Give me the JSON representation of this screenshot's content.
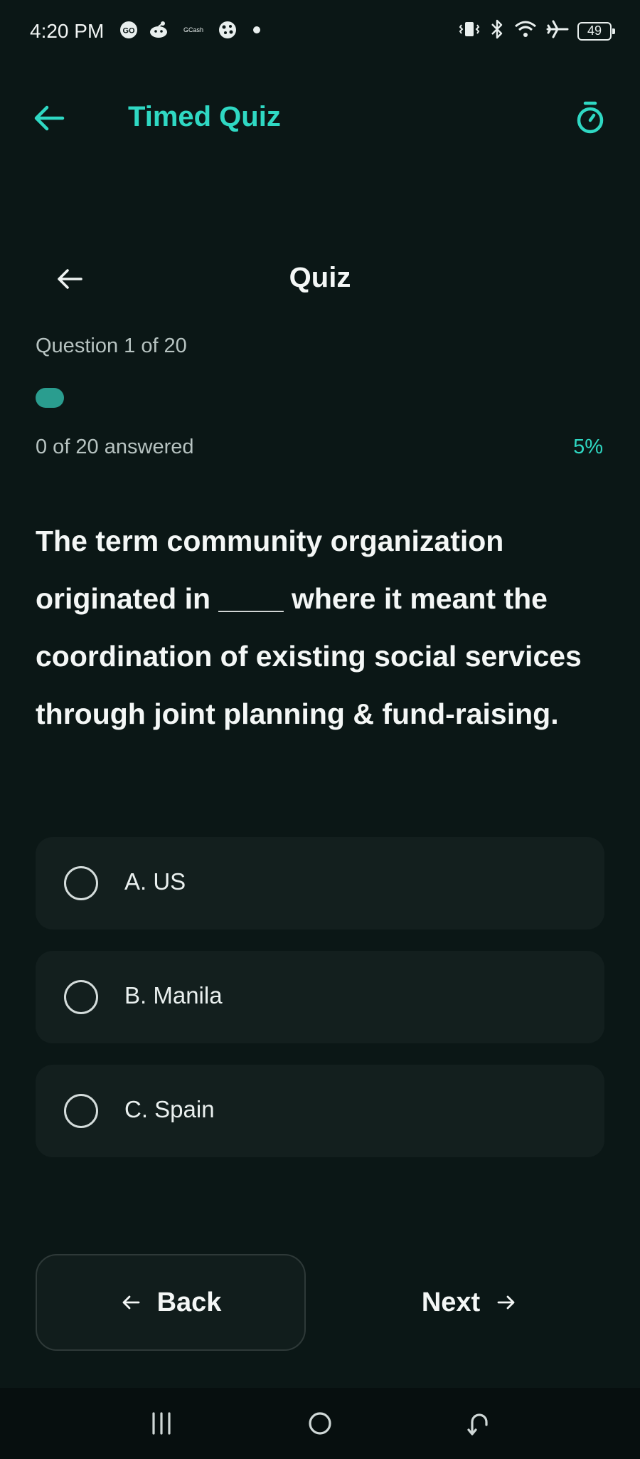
{
  "status_bar": {
    "time": "4:20 PM",
    "left_icons": [
      "go-icon",
      "reddit-icon",
      "gcash-icon",
      "globe-icon",
      "dot-icon"
    ],
    "gcash_label": "GCash",
    "battery": "49"
  },
  "app_bar": {
    "title": "Timed Quiz",
    "back_icon": "arrow-left-icon",
    "timer_icon": "stopwatch-icon"
  },
  "quiz": {
    "header_title": "Quiz",
    "question_counter": "Question 1 of 20",
    "progress_fraction": 0.05,
    "answered_text": "0 of 20 answered",
    "percent_text": "5%",
    "question_text": "The term community organization originated in ____ where it meant the coordination of existing social services through joint planning & fund-raising.",
    "options": [
      {
        "label": "A. US",
        "selected": false
      },
      {
        "label": "B. Manila",
        "selected": false
      },
      {
        "label": "C. Spain",
        "selected": false
      }
    ]
  },
  "actions": {
    "back_label": "Back",
    "next_label": "Next"
  },
  "colors": {
    "background": "#0b1716",
    "accent": "#2fd8c3",
    "progress": "#2a9d8f",
    "card": "#131f1e"
  },
  "nav_bar": {
    "icons": [
      "recents-icon",
      "home-icon",
      "back-gesture-icon"
    ]
  }
}
